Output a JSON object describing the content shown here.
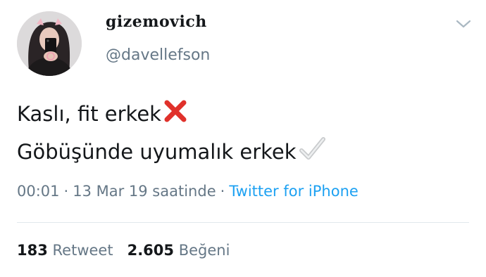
{
  "tweet": {
    "author": {
      "display_name": "gizemovich",
      "handle": "@davellefson",
      "avatar_icon": "profile-photo-avatar"
    },
    "menu_icon": "chevron-down-icon",
    "text_line_1": "Kaslı, fit erkek",
    "text_line_1_emoji": "cross-mark-emoji",
    "text_line_2": "Göbüşünde uyumalık erkek",
    "text_line_2_emoji": "check-mark-emoji",
    "time": "00:01",
    "separator": "·",
    "date": "13 Mar 19 saatinde",
    "source": "Twitter for iPhone",
    "retweet_count": "183",
    "retweet_label": "Retweet",
    "like_count": "2.605",
    "like_label": "Beğeni",
    "colors": {
      "link": "#1da1f2",
      "secondary_text": "#657786",
      "cross_mark": "#e0312b"
    }
  }
}
